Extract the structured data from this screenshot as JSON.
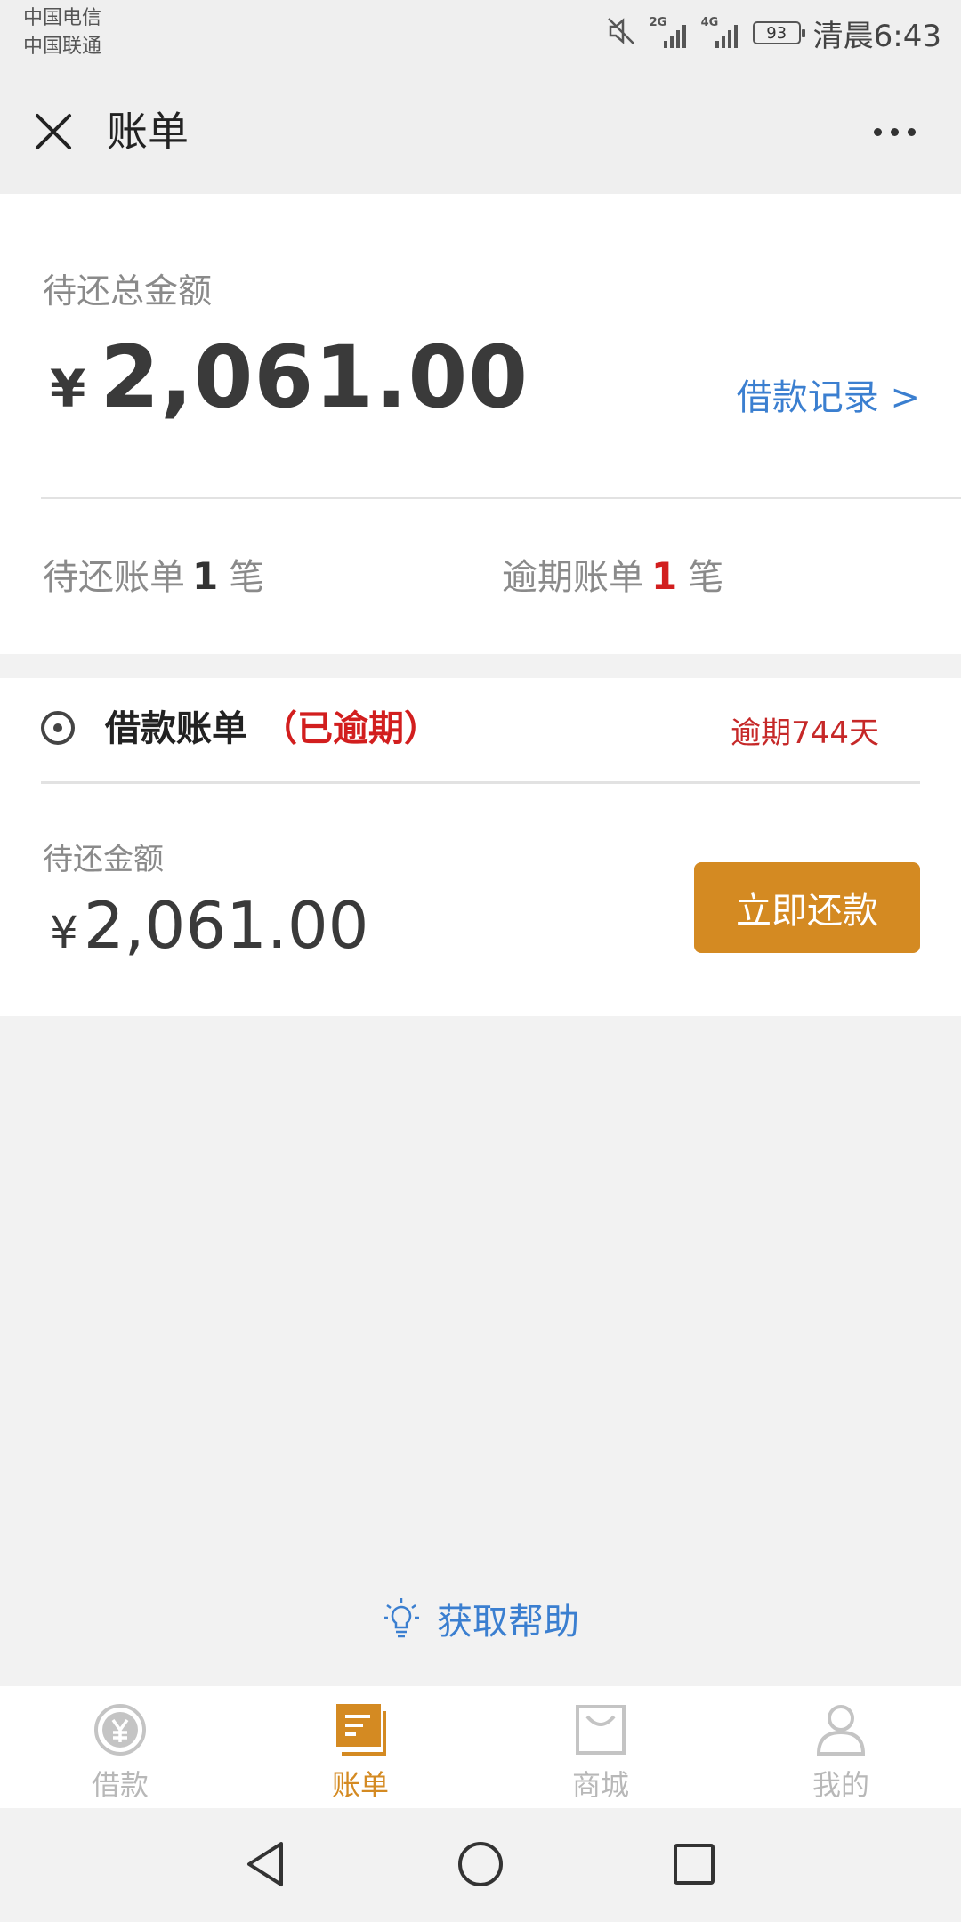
{
  "status_bar": {
    "carrier_1": "中国电信",
    "carrier_2": "中国联通",
    "signal_1": "2G",
    "signal_2": "4G",
    "battery": "93",
    "time": "清晨6:43"
  },
  "header": {
    "title": "账单",
    "close_icon": "close-icon",
    "more_icon": "more-icon"
  },
  "summary": {
    "total_label": "待还总金额",
    "currency": "¥",
    "total_amount": "2,061.00",
    "records_link": "借款记录 >",
    "pending_prefix": "待还账单",
    "pending_count": "1",
    "pending_suffix": "笔",
    "overdue_prefix": "逾期账单",
    "overdue_count": "1",
    "overdue_suffix": "笔"
  },
  "bill": {
    "title": "借款账单",
    "status": "（已逾期）",
    "overdue_days": "逾期744天",
    "due_label": "待还金额",
    "currency": "¥",
    "due_amount": "2,061.00",
    "repay_button": "立即还款"
  },
  "help": {
    "label": "获取帮助",
    "icon": "lightbulb-icon"
  },
  "tabs": [
    {
      "label": "借款",
      "icon": "yuan-coin-icon",
      "active": false
    },
    {
      "label": "账单",
      "icon": "bill-icon",
      "active": true
    },
    {
      "label": "商城",
      "icon": "shopping-bag-icon",
      "active": false
    },
    {
      "label": "我的",
      "icon": "person-icon",
      "active": false
    }
  ],
  "colors": {
    "accent": "#d48a22",
    "link": "#3b7fd0",
    "alert": "#d21e1e"
  }
}
